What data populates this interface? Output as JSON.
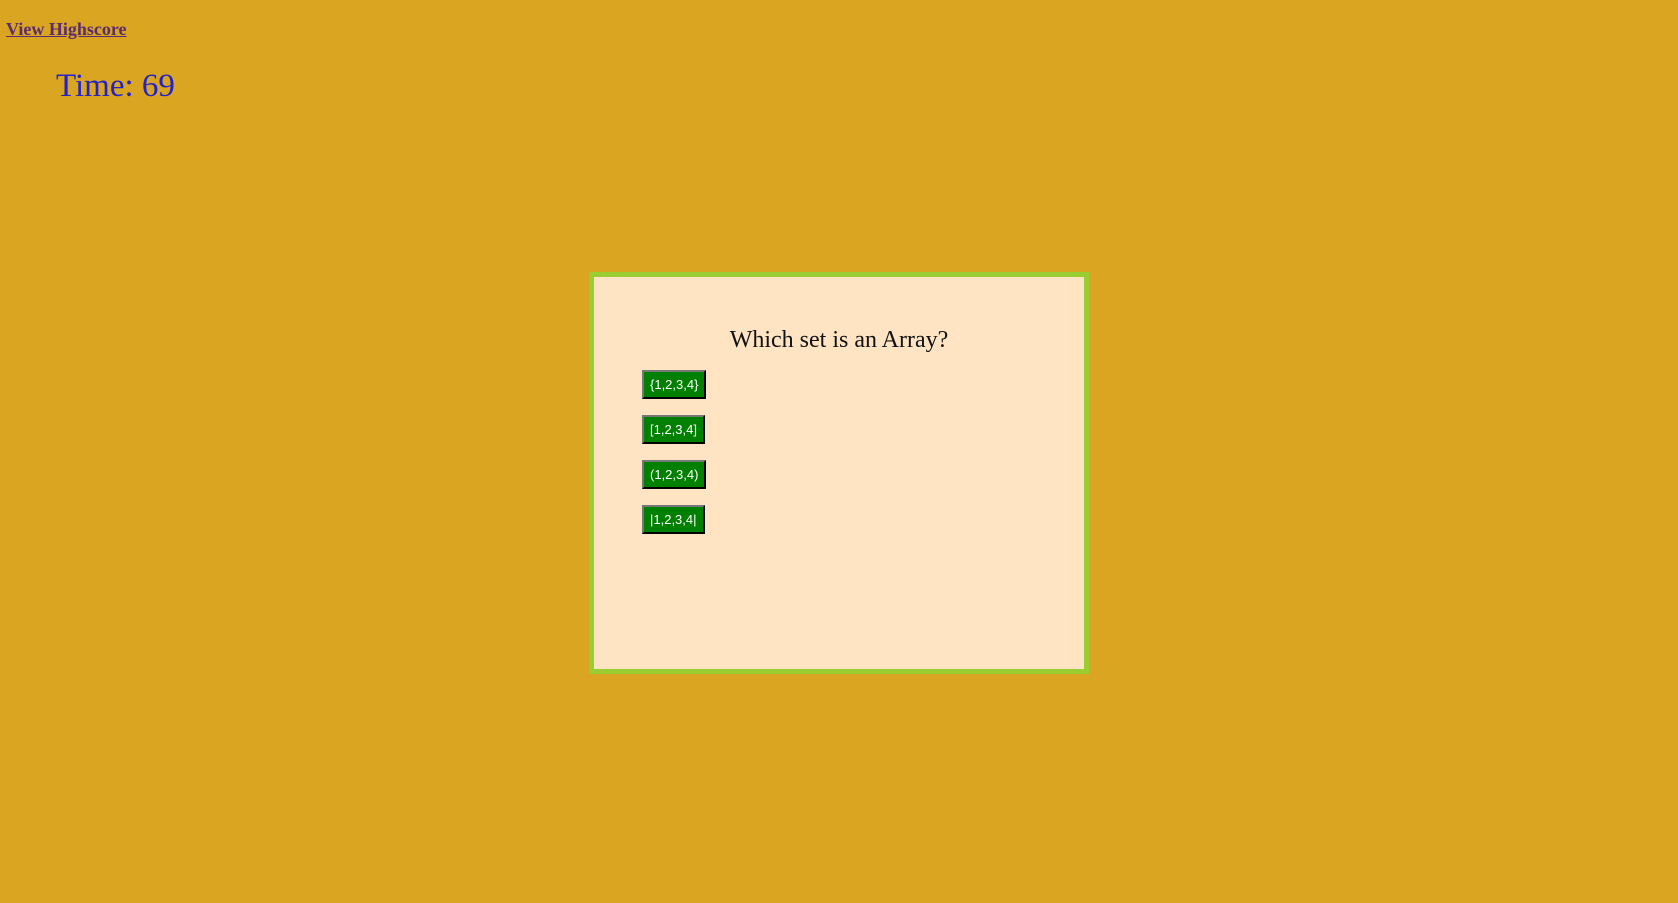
{
  "header": {
    "highscore_link": "View Highscore",
    "timer_label": "Time:",
    "timer_value": "69"
  },
  "quiz": {
    "question": "Which set is an Array?",
    "choices": [
      "{1,2,3,4}",
      "[1,2,3,4]",
      "(1,2,3,4)",
      "|1,2,3,4|"
    ]
  },
  "colors": {
    "page_background": "#daa520",
    "card_background": "#ffe4c4",
    "card_border": "#9acd32",
    "button_background": "#008000",
    "timer_text": "#2323c8",
    "link_text": "#5b2c6f"
  }
}
